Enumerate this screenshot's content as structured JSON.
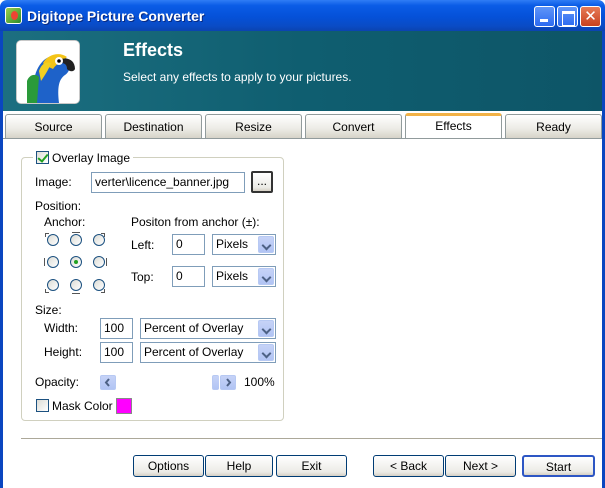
{
  "window": {
    "title": "Digitope Picture Converter",
    "close_glyph": "✕"
  },
  "header": {
    "title": "Effects",
    "subtitle": "Select any effects to apply to your pictures."
  },
  "tabs": [
    "Source",
    "Destination",
    "Resize",
    "Convert",
    "Effects",
    "Ready"
  ],
  "active_tab": "Effects",
  "overlay": {
    "enabled_label": "Overlay Image",
    "checked": true,
    "image_label": "Image:",
    "image_value": "verter\\licence_banner.jpg",
    "browse_label": "...",
    "position_label": "Position:",
    "anchor_label": "Anchor:",
    "anchor_selected": "center",
    "offset_label": "Positon from anchor (±):",
    "left_label": "Left:",
    "left_value": "0",
    "left_unit": "Pixels",
    "top_label": "Top:",
    "top_value": "0",
    "top_unit": "Pixels",
    "size_label": "Size:",
    "width_label": "Width:",
    "width_value": "100",
    "width_unit": "Percent of Overlay",
    "height_label": "Height:",
    "height_value": "100",
    "height_unit": "Percent of Overlay",
    "opacity_label": "Opacity:",
    "opacity_value": "100%",
    "opacity_level": 1.0,
    "mask_label": "Mask Color",
    "mask_checked": false,
    "mask_color": "#ff00ff"
  },
  "buttons": {
    "options": "Options",
    "help": "Help",
    "exit": "Exit",
    "back": "< Back",
    "next": "Next >",
    "start": "Start"
  }
}
